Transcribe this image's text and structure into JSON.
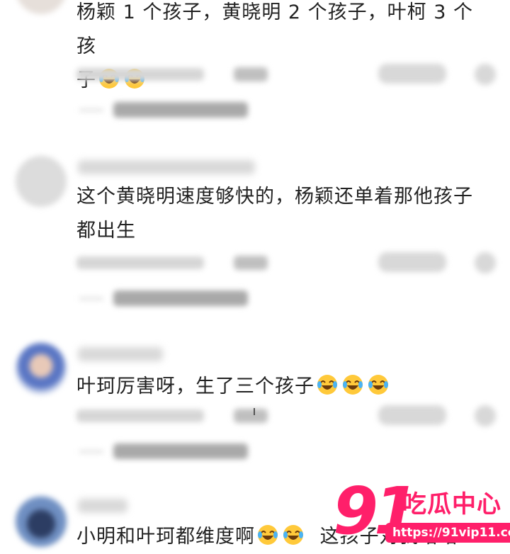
{
  "comments": [
    {
      "text_line1": "杨颖 1 个孩子，黄晓明 2 个孩子，叶柯 3 个孩",
      "text_line2": "子",
      "emoji_count": 2
    },
    {
      "text_line1": "这个黄晓明速度够快的，杨颖还单着那他孩子",
      "text_line2": "都出生"
    },
    {
      "text_line1": "叶珂厉害呀，生了三个孩子",
      "emoji_count": 3
    },
    {
      "text_line1": "小明和叶珂都维度啊",
      "text_after": "这孩子对我哈哈"
    }
  ],
  "watermark": {
    "number": "91",
    "name": "吃瓜中心",
    "url": "https://91vip11.com"
  },
  "colors": {
    "brand": "#ff1f6a",
    "text": "#222222",
    "blurred": "#d6d6d6"
  },
  "icons": {
    "emoji": "laughing-tears-emoji",
    "like": "heart-icon",
    "dislike": "dislike-icon"
  }
}
